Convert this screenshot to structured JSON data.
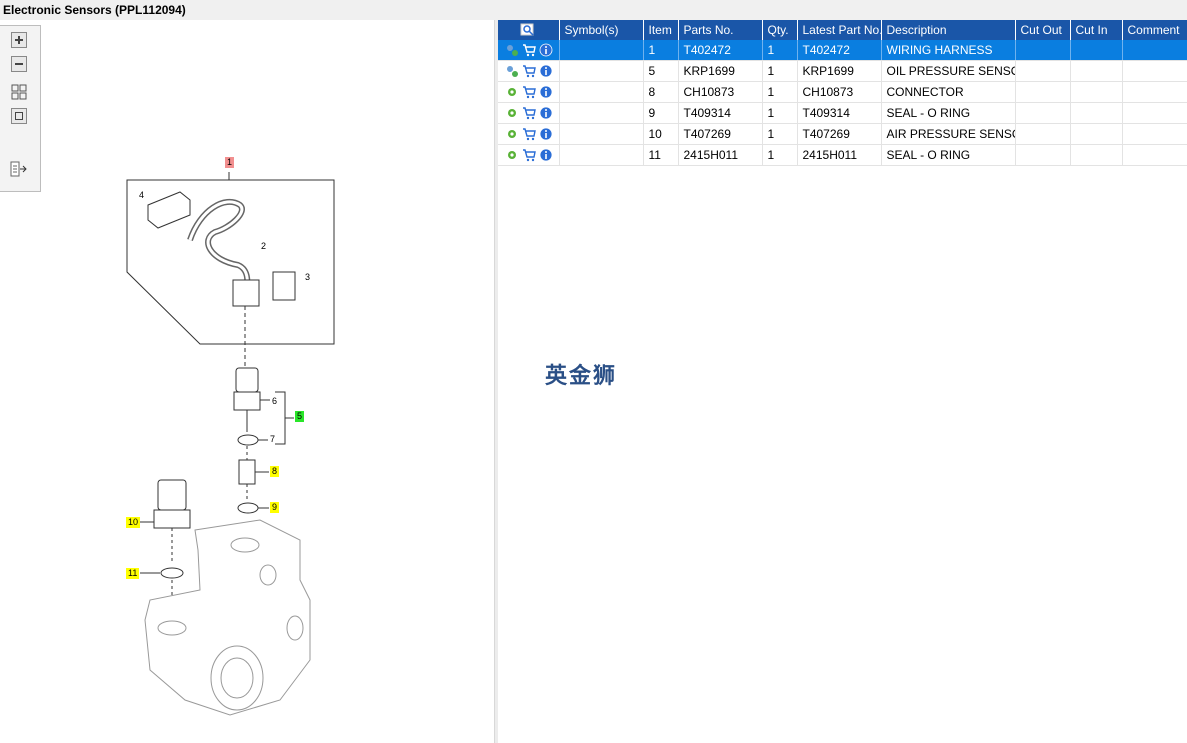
{
  "window": {
    "title": "Electronic Sensors (PPL112094)"
  },
  "diagram": {
    "callouts": [
      {
        "label": "1",
        "style": "red"
      },
      {
        "label": "5",
        "style": "green"
      },
      {
        "label": "8",
        "style": "yellow"
      },
      {
        "label": "9",
        "style": "yellow"
      },
      {
        "label": "10",
        "style": "yellow"
      },
      {
        "label": "11",
        "style": "yellow"
      }
    ],
    "plain_numbers": [
      "4",
      "2",
      "3",
      "6",
      "7"
    ]
  },
  "toolbar": {
    "zoom_in_icon": "zoom-in-icon",
    "zoom_out_icon": "zoom-out-icon",
    "fit_icon": "fit-all-icon",
    "reset_icon": "actual-size-icon",
    "export_icon": "export-list-icon"
  },
  "grid": {
    "columns": [
      "",
      "Symbol(s)",
      "Item",
      "Parts No.",
      "Qty.",
      "Latest Part No.",
      "Description",
      "Cut Out",
      "Cut In",
      "Comment"
    ],
    "rows": [
      {
        "item": "1",
        "part_no": "T402472",
        "qty": "1",
        "latest": "T402472",
        "desc": "WIRING HARNESS",
        "selected": true
      },
      {
        "item": "5",
        "part_no": "KRP1699",
        "qty": "1",
        "latest": "KRP1699",
        "desc": "OIL PRESSURE SENSOR KIT",
        "selected": false
      },
      {
        "item": "8",
        "part_no": "CH10873",
        "qty": "1",
        "latest": "CH10873",
        "desc": "CONNECTOR",
        "selected": false
      },
      {
        "item": "9",
        "part_no": "T409314",
        "qty": "1",
        "latest": "T409314",
        "desc": "SEAL - O RING",
        "selected": false
      },
      {
        "item": "10",
        "part_no": "T407269",
        "qty": "1",
        "latest": "T407269",
        "desc": "AIR PRESSURE SENSOR",
        "selected": false
      },
      {
        "item": "11",
        "part_no": "2415H011",
        "qty": "1",
        "latest": "2415H011",
        "desc": "SEAL - O RING",
        "selected": false
      }
    ]
  },
  "watermark": "英金狮",
  "colors": {
    "header": "#1a56a8",
    "selection": "#0a7ee0"
  }
}
